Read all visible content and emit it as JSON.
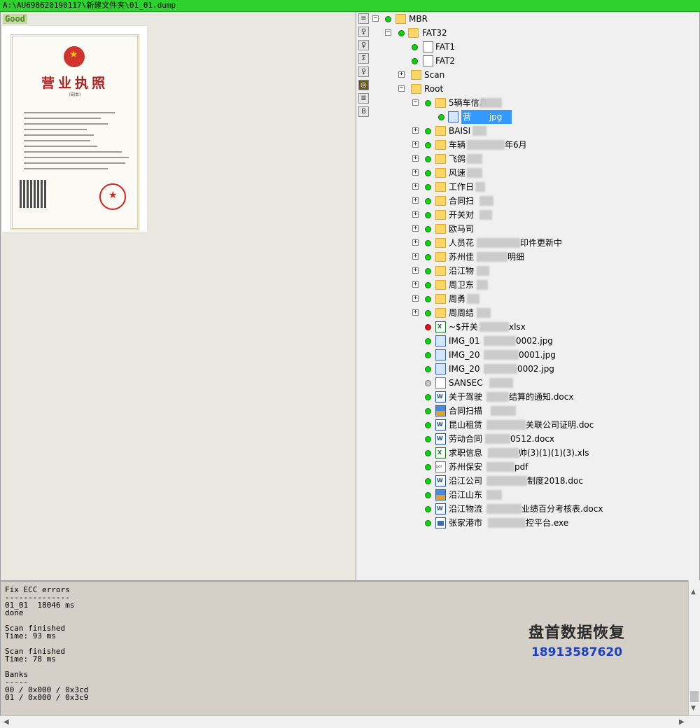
{
  "window": {
    "title": "A:\\AU698620190117\\新建文件夹\\01_01.dump"
  },
  "left_pane": {
    "status": "Good"
  },
  "preview": {
    "doc_title": "营业执照",
    "doc_subtitle": "(副本)"
  },
  "toolbar": {
    "buttons": [
      "list-icon",
      "key-icon",
      "key-icon",
      "scan-icon",
      "key-icon",
      "eye-icon",
      "text-icon",
      "B"
    ]
  },
  "tree": {
    "mbr": "MBR",
    "fat32": "FAT32",
    "fat1": "FAT1",
    "fat2": "FAT2",
    "scan": "Scan",
    "root": "Root",
    "items": [
      "5辆车信息",
      "营",
      "BAISI",
      "车辆",
      "年6月",
      "飞鸽",
      "风速",
      "工作日",
      "合同扫",
      "开关对",
      "欧马司",
      "人员花",
      "印件更新中",
      "苏州佳",
      "明细",
      "沿江物",
      "周卫东",
      "周勇",
      "周周结",
      "~$开关",
      "xlsx",
      "IMG_01",
      "0002.jpg",
      "IMG_20",
      "0001.jpg",
      "IMG_20",
      "0002.jpg",
      "SANSEC",
      "关于驾驶",
      "结算的通知.docx",
      "合同扫描",
      "昆山租赁",
      "关联公司证明.doc",
      "劳动合同",
      "0512.docx",
      "求职信息",
      "帅(3)(1)(1)(3).xls",
      "苏州保安",
      "pdf",
      "沿江公司",
      "制度2018.doc",
      "沿江山东",
      "沿江物流",
      "业绩百分考核表.docx",
      "张家港市",
      "控平台.exe",
      "jpg"
    ]
  },
  "log": {
    "lines": [
      "Fix ECC errors",
      "--------------",
      "01_01  18046 ms",
      "done",
      "",
      "Scan finished",
      "Time: 93 ms",
      "",
      "Scan finished",
      "Time: 78 ms",
      "",
      "Banks",
      "-----",
      "00 / 0x000 / 0x3cd",
      "01 / 0x000 / 0x3c9"
    ]
  },
  "watermark": {
    "line1": "盘首数据恢复",
    "line2": "18913587620"
  }
}
